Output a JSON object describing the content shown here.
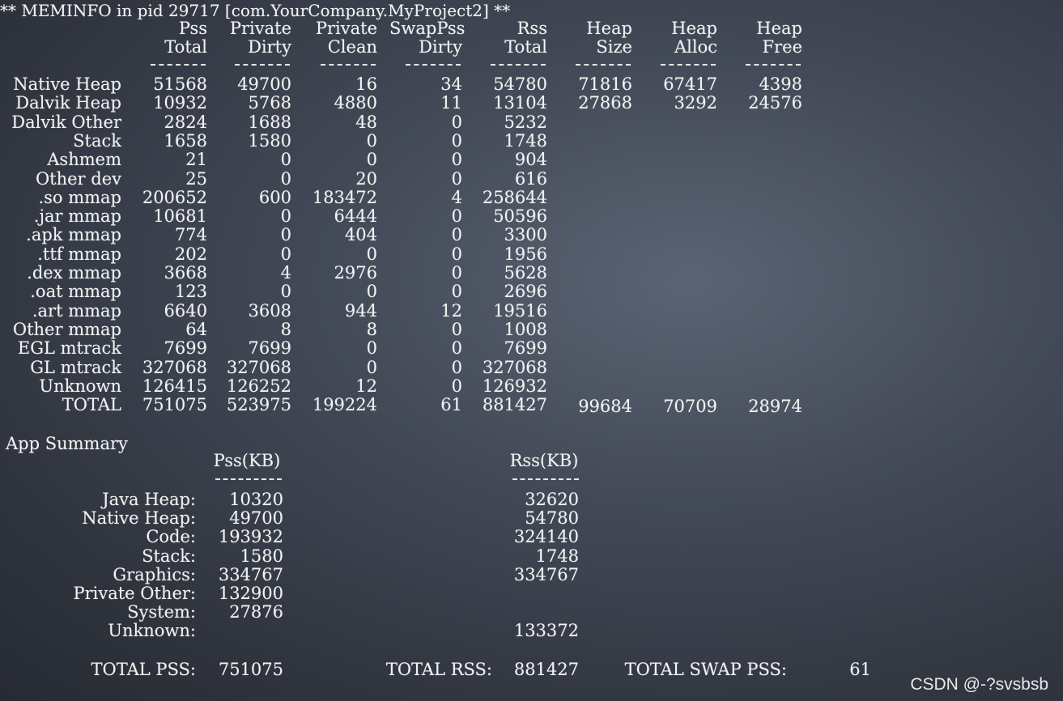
{
  "header": "** MEMINFO in pid 29717 [com.YourCompany.MyProject2] **",
  "columns": [
    {
      "line1": "Pss",
      "line2": "Total"
    },
    {
      "line1": "Private",
      "line2": "Dirty"
    },
    {
      "line1": "Private",
      "line2": "Clean"
    },
    {
      "line1": "SwapPss",
      "line2": "Dirty"
    },
    {
      "line1": "Rss",
      "line2": "Total"
    },
    {
      "line1": "Heap",
      "line2": "Size"
    },
    {
      "line1": "Heap",
      "line2": "Alloc"
    },
    {
      "line1": "Heap",
      "line2": "Free"
    }
  ],
  "separator": "------",
  "rows": [
    {
      "label": "Native Heap",
      "values": [
        "51568",
        "49700",
        "16",
        "34",
        "54780",
        "71816",
        "67417",
        "4398"
      ]
    },
    {
      "label": "Dalvik Heap",
      "values": [
        "10932",
        "5768",
        "4880",
        "11",
        "13104",
        "27868",
        "3292",
        "24576"
      ]
    },
    {
      "label": "Dalvik Other",
      "values": [
        "2824",
        "1688",
        "48",
        "0",
        "5232",
        "",
        "",
        ""
      ]
    },
    {
      "label": "Stack",
      "values": [
        "1658",
        "1580",
        "0",
        "0",
        "1748",
        "",
        "",
        ""
      ]
    },
    {
      "label": "Ashmem",
      "values": [
        "21",
        "0",
        "0",
        "0",
        "904",
        "",
        "",
        ""
      ]
    },
    {
      "label": "Other dev",
      "values": [
        "25",
        "0",
        "20",
        "0",
        "616",
        "",
        "",
        ""
      ]
    },
    {
      "label": ".so mmap",
      "values": [
        "200652",
        "600",
        "183472",
        "4",
        "258644",
        "",
        "",
        ""
      ]
    },
    {
      "label": ".jar mmap",
      "values": [
        "10681",
        "0",
        "6444",
        "0",
        "50596",
        "",
        "",
        ""
      ]
    },
    {
      "label": ".apk mmap",
      "values": [
        "774",
        "0",
        "404",
        "0",
        "3300",
        "",
        "",
        ""
      ]
    },
    {
      "label": ".ttf mmap",
      "values": [
        "202",
        "0",
        "0",
        "0",
        "1956",
        "",
        "",
        ""
      ]
    },
    {
      "label": ".dex mmap",
      "values": [
        "3668",
        "4",
        "2976",
        "0",
        "5628",
        "",
        "",
        ""
      ]
    },
    {
      "label": ".oat mmap",
      "values": [
        "123",
        "0",
        "0",
        "0",
        "2696",
        "",
        "",
        ""
      ]
    },
    {
      "label": ".art mmap",
      "values": [
        "6640",
        "3608",
        "944",
        "12",
        "19516",
        "",
        "",
        ""
      ]
    },
    {
      "label": "Other mmap",
      "values": [
        "64",
        "8",
        "8",
        "0",
        "1008",
        "",
        "",
        ""
      ]
    },
    {
      "label": "EGL mtrack",
      "values": [
        "7699",
        "7699",
        "0",
        "0",
        "7699",
        "",
        "",
        ""
      ]
    },
    {
      "label": "GL mtrack",
      "values": [
        "327068",
        "327068",
        "0",
        "0",
        "327068",
        "",
        "",
        ""
      ]
    },
    {
      "label": "Unknown",
      "values": [
        "126415",
        "126252",
        "12",
        "0",
        "126932",
        "",
        "",
        ""
      ]
    },
    {
      "label": "TOTAL",
      "values": [
        "751075",
        "523975",
        "199224",
        "61",
        "881427",
        "99684",
        "70709",
        "28974"
      ]
    }
  ],
  "summary": {
    "title": "App Summary",
    "pss_header": "Pss(KB)",
    "rss_header": "Rss(KB)",
    "separator": "------",
    "rows": [
      {
        "label": "Java Heap:",
        "pss": "10320",
        "rss": "32620"
      },
      {
        "label": "Native Heap:",
        "pss": "49700",
        "rss": "54780"
      },
      {
        "label": "Code:",
        "pss": "193932",
        "rss": "324140"
      },
      {
        "label": "Stack:",
        "pss": "1580",
        "rss": "1748"
      },
      {
        "label": "Graphics:",
        "pss": "334767",
        "rss": "334767"
      },
      {
        "label": "Private Other:",
        "pss": "132900",
        "rss": ""
      },
      {
        "label": "System:",
        "pss": "27876",
        "rss": ""
      },
      {
        "label": "Unknown:",
        "pss": "",
        "rss": "133372"
      }
    ]
  },
  "totals": {
    "pss_label": "TOTAL PSS:",
    "pss_value": "751075",
    "rss_label": "TOTAL RSS:",
    "rss_value": "881427",
    "swap_label": "TOTAL SWAP PSS:",
    "swap_value": "61"
  },
  "watermark": "CSDN @-?svsbsb"
}
